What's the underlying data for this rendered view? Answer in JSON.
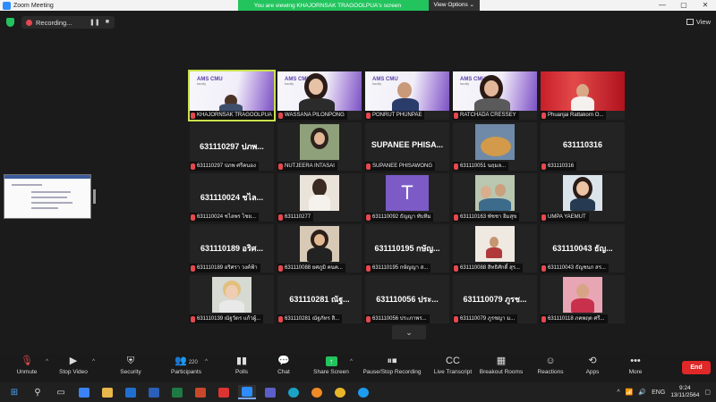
{
  "window": {
    "title": "Zoom Meeting"
  },
  "banner": {
    "message": "You are viewing KHAJORNSAK TRAGOOLPUA's screen",
    "view_options": "View Options"
  },
  "recording": {
    "label": "Recording..."
  },
  "view_button": {
    "label": "View"
  },
  "participants": [
    {
      "display": "slide",
      "name": "KHAJORNSAK TRAGOOLPUA",
      "active": true
    },
    {
      "display": "slide-woman",
      "name": "WASSANA PILONPONG"
    },
    {
      "display": "slide-man",
      "name": "PONRUT PHUNPAE"
    },
    {
      "display": "slide-woman2",
      "name": "RATCHADA CRESSEY"
    },
    {
      "display": "photo-red",
      "name": "Phuanjai Rattakorn O..."
    },
    {
      "display": "text",
      "big": "631110297 ปภพ...",
      "name": "631110297 ปภพ ศรีคนอง"
    },
    {
      "display": "photo-girl",
      "name": "NUTJEERA INTASAI"
    },
    {
      "display": "text",
      "big": "SUPANEE PHISA...",
      "name": "SUPANEE PHISAWONG"
    },
    {
      "display": "photo-dog",
      "name": "631110051 นฤมล..."
    },
    {
      "display": "text",
      "big": "631110316",
      "name": "631110316"
    },
    {
      "display": "text",
      "big": "631110024 ชไล...",
      "name": "631110024 ชไลพร ไชย..."
    },
    {
      "display": "photo-girl2",
      "name": "631110277"
    },
    {
      "display": "avatar",
      "letter": "T",
      "name": "631110092 ธัญญา ทับทิม"
    },
    {
      "display": "photo-group",
      "name": "631110163 พัชชา อิ่มสุข"
    },
    {
      "display": "photo-woman",
      "name": "UMPA YAEMUT"
    },
    {
      "display": "text",
      "big": "631110189 อริศ...",
      "name": "631110189 อริศรา วงค์ฟ้า"
    },
    {
      "display": "photo-girl3",
      "name": "631110088 ยศภูมิ คนค..."
    },
    {
      "display": "text",
      "big": "631110195 กษัญ...",
      "name": "631110195 กษัญญา ส..."
    },
    {
      "display": "photo-room",
      "name": "631110088 สิทธิศักดิ์ สุร..."
    },
    {
      "display": "text",
      "big": "631110043 ธัญ...",
      "name": "631110043 ธัญชนก สร..."
    },
    {
      "display": "photo-boy",
      "name": "631110139 ณัฐวัตร แก้วผู้..."
    },
    {
      "display": "text",
      "big": "631110281 ณัฐ...",
      "name": "631110281 ณัฐภัทร สิ..."
    },
    {
      "display": "text",
      "big": "631110056 ประ...",
      "name": "631110056 ประภาพร..."
    },
    {
      "display": "text",
      "big": "631110079 ภูรช...",
      "name": "631110079 ภูรชญา ม..."
    },
    {
      "display": "photo-pink",
      "name": "631110118 ภคพฤต ศรี..."
    }
  ],
  "toolbar": {
    "unmute": "Unmute",
    "stop_video": "Stop Video",
    "security": "Security",
    "participants": "Participants",
    "participants_count": "220",
    "polls": "Polls",
    "chat": "Chat",
    "share_screen": "Share Screen",
    "pause_recording": "Pause/Stop Recording",
    "live_transcript": "Live Transcript",
    "breakout_rooms": "Breakout Rooms",
    "reactions": "Reactions",
    "apps": "Apps",
    "more": "More",
    "end": "End"
  },
  "taskbar": {
    "time": "9:24",
    "date": "13/11/2564"
  },
  "colors": {
    "accent_green": "#23c45e",
    "end_red": "#e02828",
    "active_outline": "#c9e24e",
    "zoom_blue": "#2d8cff"
  }
}
